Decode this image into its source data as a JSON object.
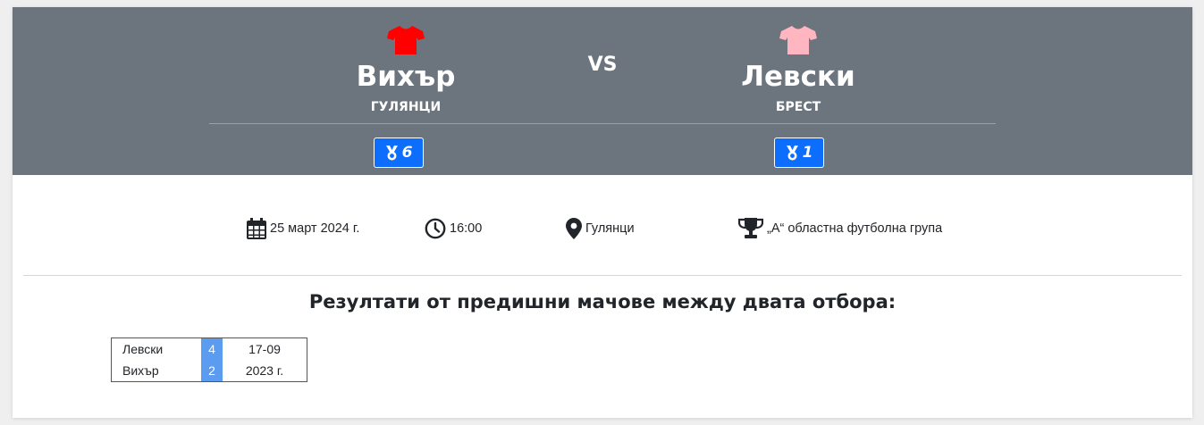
{
  "match": {
    "home": {
      "name": "Вихър",
      "city": "ГУЛЯНЦИ",
      "shirt_color": "#ff0000",
      "medal_count": "6"
    },
    "away": {
      "name": "Левски",
      "city": "БРЕСТ",
      "shirt_color": "#ffb6c1",
      "medal_count": "1"
    },
    "vs_label": "VS"
  },
  "info": {
    "date": "25 март 2024 г.",
    "date_icon": "calendar-icon",
    "time": "16:00",
    "time_icon": "clock-icon",
    "place": "Гулянци",
    "place_icon": "map-pin-icon",
    "league": "„А“ областна футболна група",
    "league_icon": "trophy-icon"
  },
  "previous_matches": {
    "title": "Резултати от предишни мачове между двата отбора:",
    "accent_color": "#5b9bf0",
    "items": [
      {
        "team1": "Левски",
        "score1": "4",
        "team2": "Вихър",
        "score2": "2",
        "date_line1": "17-09",
        "date_line2": "2023 г."
      }
    ]
  },
  "colors": {
    "header_bg": "#6c757d",
    "badge_bg": "#0d6efd"
  }
}
